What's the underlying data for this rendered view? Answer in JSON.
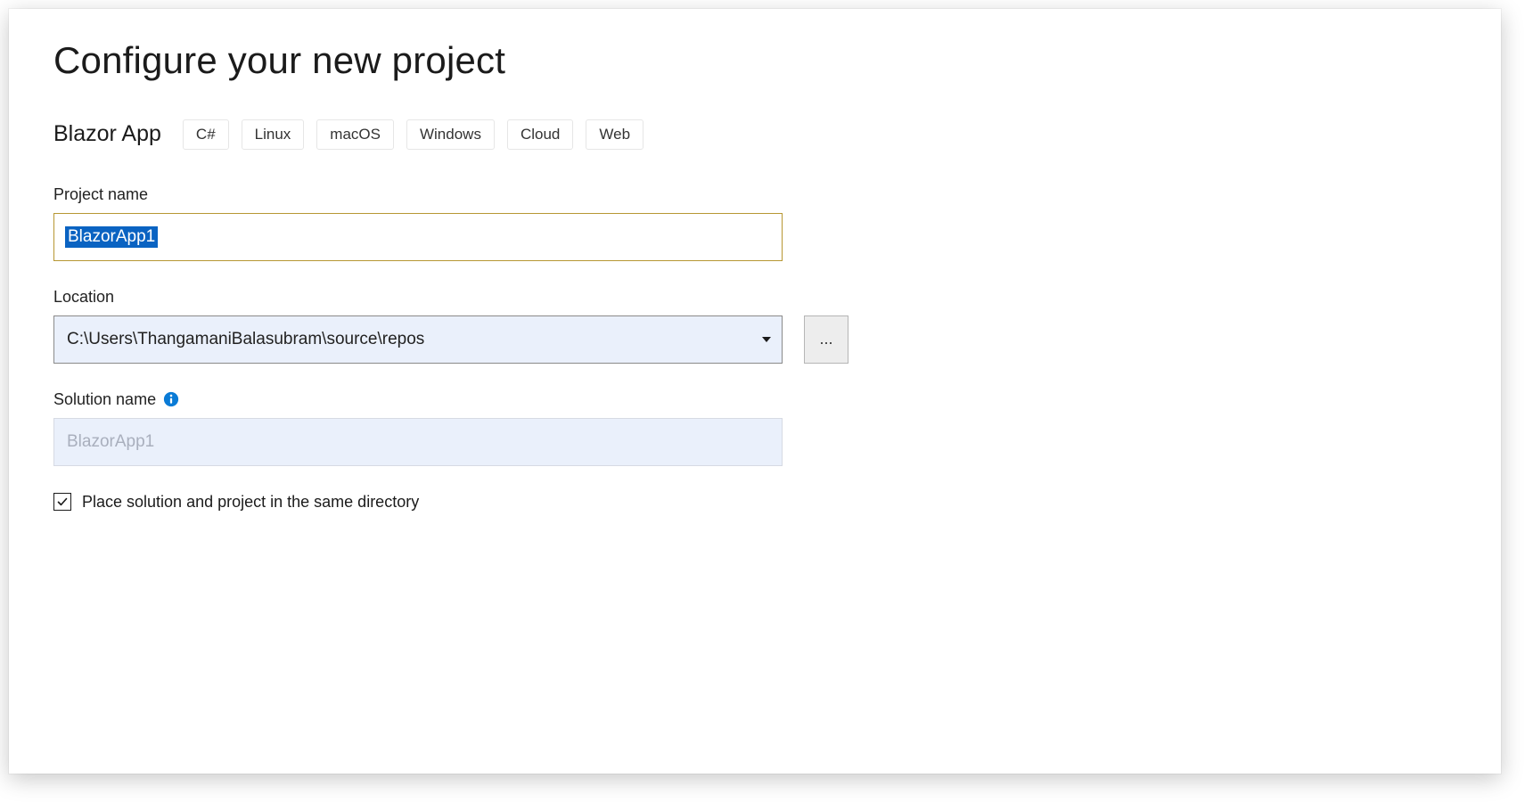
{
  "title": "Configure your new project",
  "template": {
    "name": "Blazor App",
    "tags": [
      "C#",
      "Linux",
      "macOS",
      "Windows",
      "Cloud",
      "Web"
    ]
  },
  "fields": {
    "project_name_label": "Project name",
    "project_name_value": "BlazorApp1",
    "location_label": "Location",
    "location_value": "C:\\Users\\ThangamaniBalasubram\\source\\repos",
    "browse_label": "...",
    "solution_name_label": "Solution name",
    "solution_name_value": "BlazorApp1",
    "same_dir_label": "Place solution and project in the same directory",
    "same_dir_checked": true
  }
}
